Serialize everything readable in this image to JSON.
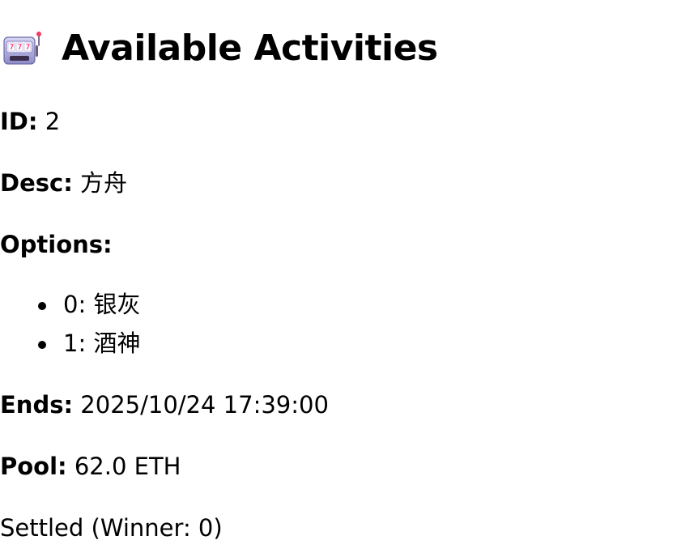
{
  "header": {
    "icon": "slot-machine-icon",
    "title": "Available Activities"
  },
  "activity": {
    "id_label": "ID:",
    "id_value": "2",
    "desc_label": "Desc:",
    "desc_value": "方舟",
    "options_label": "Options:",
    "options": [
      {
        "text": "0: 银灰"
      },
      {
        "text": "1: 酒神"
      }
    ],
    "ends_label": "Ends:",
    "ends_value": "2025/10/24 17:39:00",
    "pool_label": "Pool:",
    "pool_value": "62.0 ETH",
    "status": "Settled (Winner: 0)"
  }
}
